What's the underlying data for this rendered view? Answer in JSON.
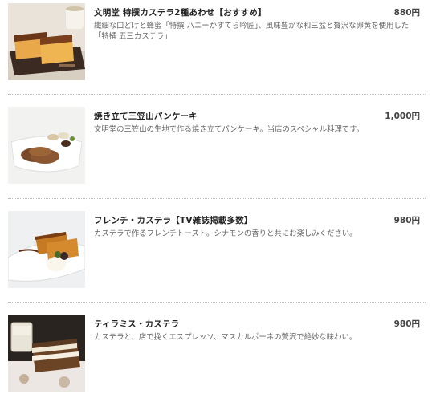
{
  "menu": {
    "items": [
      {
        "name": "文明堂 特撰カステラ2種あわせ【おすすめ】",
        "price": "880円",
        "description": "繊細な口どけと蜂蜜「特撰 ハニーかすてら吟匠」、風味豊かな和三盆と贅沢な卵黄を使用した「特撰 五三カステラ」",
        "image": "castella-assortment-photo"
      },
      {
        "name": "焼き立て三笠山パンケーキ",
        "price": "1,000円",
        "description": "文明堂の三笠山の生地で作る焼き立てパンケーキ。当店のスペシャル料理です。",
        "image": "pancake-photo"
      },
      {
        "name": "フレンチ・カステラ【TV雑誌掲載多数】",
        "price": "980円",
        "description": "カステラで作るフレンチトースト。シナモンの香りと共にお楽しみください。",
        "image": "french-castella-photo"
      },
      {
        "name": "ティラミス・カステラ",
        "price": "980円",
        "description": "カステラと、店で挽くエスプレッソ、マスカルポーネの贅沢で絶妙な味わい。",
        "image": "tiramisu-castella-photo"
      }
    ]
  }
}
